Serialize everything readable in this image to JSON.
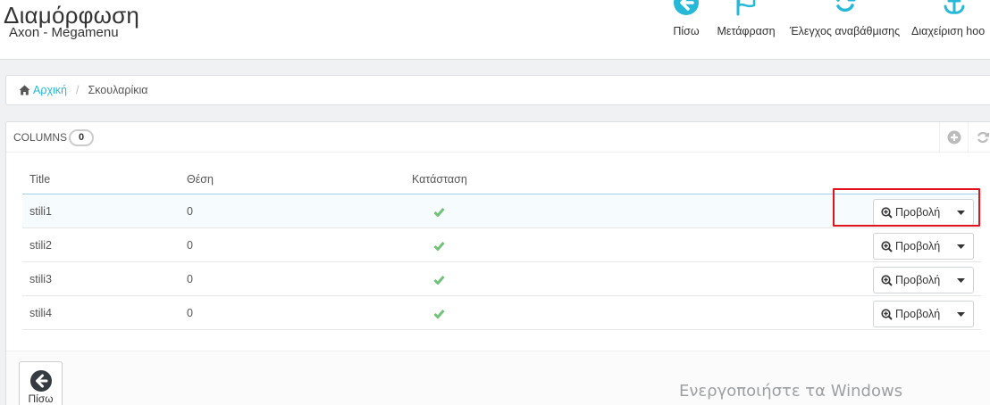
{
  "header": {
    "title": "Διαμόρφωση",
    "subtitle": "Axon - Megamenu"
  },
  "toolbar": {
    "back_label": "Πίσω",
    "translate_label": "Μετάφραση",
    "update_label": "Έλεγχος αναβάθμισης",
    "hooks_label": "Διαχείριση hoo"
  },
  "breadcrumb": {
    "home_label": "Αρχική",
    "separator": "/",
    "current": "Σκουλαρίκια"
  },
  "panel": {
    "title": "COLUMNS",
    "count": "0"
  },
  "table": {
    "columns": [
      "Title",
      "Θέση",
      "Κατάσταση"
    ],
    "rows": [
      {
        "title": "stili1",
        "position": "0",
        "status": "enabled"
      },
      {
        "title": "stili2",
        "position": "0",
        "status": "enabled"
      },
      {
        "title": "stili3",
        "position": "0",
        "status": "enabled"
      },
      {
        "title": "stili4",
        "position": "0",
        "status": "enabled"
      }
    ],
    "view_label": "Προβολή"
  },
  "footer": {
    "back_label": "Πίσω"
  },
  "watermark": "Ενεργοποιήστε τα Windows",
  "colors": {
    "accent": "#25b9d7",
    "success": "#72c279",
    "highlight": "#e3131c"
  }
}
